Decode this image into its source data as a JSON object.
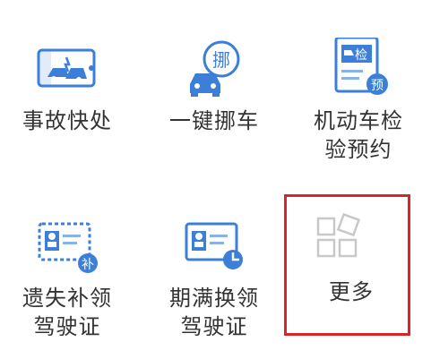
{
  "tiles": [
    {
      "id": "accident",
      "label_lines": [
        "事故快处"
      ],
      "icon": "car-accident-camera-icon"
    },
    {
      "id": "move-car",
      "label_lines": [
        "一键挪车"
      ],
      "icon": "car-move-badge-icon",
      "badge": "挪"
    },
    {
      "id": "inspection",
      "label_lines": [
        "机动车检",
        "验预约"
      ],
      "icon": "inspection-document-icon",
      "badge_top": "检",
      "badge_bottom": "预"
    },
    {
      "id": "license-reissue",
      "label_lines": [
        "遗失补领",
        "驾驶证"
      ],
      "icon": "license-card-reissue-icon",
      "badge": "补"
    },
    {
      "id": "license-renewal",
      "label_lines": [
        "期满换领",
        "驾驶证"
      ],
      "icon": "license-card-renew-icon"
    },
    {
      "id": "more",
      "label_lines": [
        "更多"
      ],
      "icon": "more-grid-icon"
    }
  ],
  "colors": {
    "primary": "#3b7fd9",
    "text": "#333333",
    "highlight": "#d9242a",
    "gray_icon": "#c8c8c8"
  }
}
